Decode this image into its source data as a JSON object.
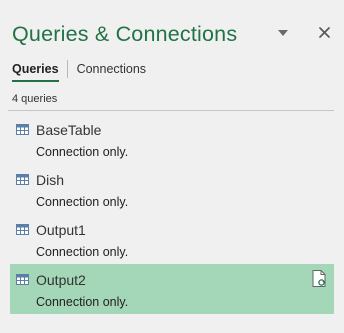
{
  "pane": {
    "title": "Queries & Connections",
    "dropdown_icon": "triangle-down-icon",
    "close_icon": "close-icon",
    "accent_color": "#217346"
  },
  "tabs": [
    {
      "label": "Queries",
      "active": true
    },
    {
      "label": "Connections",
      "active": false
    }
  ],
  "query_count_label": "4 queries",
  "queries": [
    {
      "name": "BaseTable",
      "description": "Connection only.",
      "icon": "table-icon",
      "selected": false
    },
    {
      "name": "Dish",
      "description": "Connection only.",
      "icon": "table-icon",
      "selected": false
    },
    {
      "name": "Output1",
      "description": "Connection only.",
      "icon": "table-icon",
      "selected": false
    },
    {
      "name": "Output2",
      "description": "Connection only.",
      "icon": "table-icon",
      "selected": true,
      "hover_action_icon": "document-refresh-icon"
    }
  ],
  "colors": {
    "selected_row": "#a3d7b7",
    "table_icon": "#5b7fa6"
  }
}
